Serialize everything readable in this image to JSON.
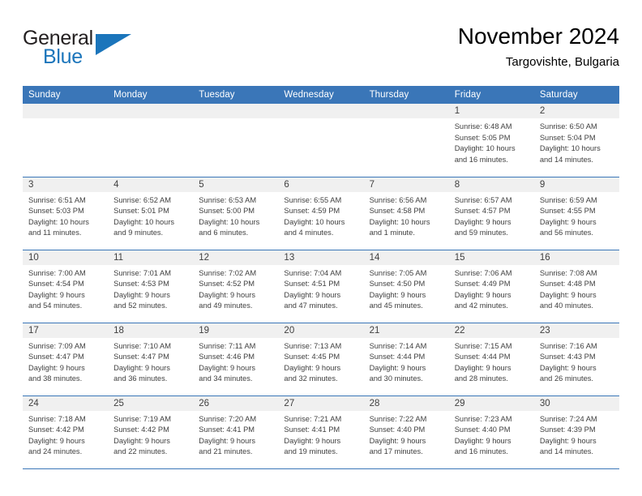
{
  "logo": {
    "word1": "General",
    "word2": "Blue",
    "accent_color": "#1b75bb"
  },
  "header": {
    "title": "November 2024",
    "location": "Targovishte, Bulgaria",
    "header_bg": "#3a76b8",
    "daynum_bg": "#f0f0f0"
  },
  "weekdays": [
    "Sunday",
    "Monday",
    "Tuesday",
    "Wednesday",
    "Thursday",
    "Friday",
    "Saturday"
  ],
  "weeks": [
    [
      {
        "day": "",
        "lines": []
      },
      {
        "day": "",
        "lines": []
      },
      {
        "day": "",
        "lines": []
      },
      {
        "day": "",
        "lines": []
      },
      {
        "day": "",
        "lines": []
      },
      {
        "day": "1",
        "lines": [
          "Sunrise: 6:48 AM",
          "Sunset: 5:05 PM",
          "Daylight: 10 hours",
          "and 16 minutes."
        ]
      },
      {
        "day": "2",
        "lines": [
          "Sunrise: 6:50 AM",
          "Sunset: 5:04 PM",
          "Daylight: 10 hours",
          "and 14 minutes."
        ]
      }
    ],
    [
      {
        "day": "3",
        "lines": [
          "Sunrise: 6:51 AM",
          "Sunset: 5:03 PM",
          "Daylight: 10 hours",
          "and 11 minutes."
        ]
      },
      {
        "day": "4",
        "lines": [
          "Sunrise: 6:52 AM",
          "Sunset: 5:01 PM",
          "Daylight: 10 hours",
          "and 9 minutes."
        ]
      },
      {
        "day": "5",
        "lines": [
          "Sunrise: 6:53 AM",
          "Sunset: 5:00 PM",
          "Daylight: 10 hours",
          "and 6 minutes."
        ]
      },
      {
        "day": "6",
        "lines": [
          "Sunrise: 6:55 AM",
          "Sunset: 4:59 PM",
          "Daylight: 10 hours",
          "and 4 minutes."
        ]
      },
      {
        "day": "7",
        "lines": [
          "Sunrise: 6:56 AM",
          "Sunset: 4:58 PM",
          "Daylight: 10 hours",
          "and 1 minute."
        ]
      },
      {
        "day": "8",
        "lines": [
          "Sunrise: 6:57 AM",
          "Sunset: 4:57 PM",
          "Daylight: 9 hours",
          "and 59 minutes."
        ]
      },
      {
        "day": "9",
        "lines": [
          "Sunrise: 6:59 AM",
          "Sunset: 4:55 PM",
          "Daylight: 9 hours",
          "and 56 minutes."
        ]
      }
    ],
    [
      {
        "day": "10",
        "lines": [
          "Sunrise: 7:00 AM",
          "Sunset: 4:54 PM",
          "Daylight: 9 hours",
          "and 54 minutes."
        ]
      },
      {
        "day": "11",
        "lines": [
          "Sunrise: 7:01 AM",
          "Sunset: 4:53 PM",
          "Daylight: 9 hours",
          "and 52 minutes."
        ]
      },
      {
        "day": "12",
        "lines": [
          "Sunrise: 7:02 AM",
          "Sunset: 4:52 PM",
          "Daylight: 9 hours",
          "and 49 minutes."
        ]
      },
      {
        "day": "13",
        "lines": [
          "Sunrise: 7:04 AM",
          "Sunset: 4:51 PM",
          "Daylight: 9 hours",
          "and 47 minutes."
        ]
      },
      {
        "day": "14",
        "lines": [
          "Sunrise: 7:05 AM",
          "Sunset: 4:50 PM",
          "Daylight: 9 hours",
          "and 45 minutes."
        ]
      },
      {
        "day": "15",
        "lines": [
          "Sunrise: 7:06 AM",
          "Sunset: 4:49 PM",
          "Daylight: 9 hours",
          "and 42 minutes."
        ]
      },
      {
        "day": "16",
        "lines": [
          "Sunrise: 7:08 AM",
          "Sunset: 4:48 PM",
          "Daylight: 9 hours",
          "and 40 minutes."
        ]
      }
    ],
    [
      {
        "day": "17",
        "lines": [
          "Sunrise: 7:09 AM",
          "Sunset: 4:47 PM",
          "Daylight: 9 hours",
          "and 38 minutes."
        ]
      },
      {
        "day": "18",
        "lines": [
          "Sunrise: 7:10 AM",
          "Sunset: 4:47 PM",
          "Daylight: 9 hours",
          "and 36 minutes."
        ]
      },
      {
        "day": "19",
        "lines": [
          "Sunrise: 7:11 AM",
          "Sunset: 4:46 PM",
          "Daylight: 9 hours",
          "and 34 minutes."
        ]
      },
      {
        "day": "20",
        "lines": [
          "Sunrise: 7:13 AM",
          "Sunset: 4:45 PM",
          "Daylight: 9 hours",
          "and 32 minutes."
        ]
      },
      {
        "day": "21",
        "lines": [
          "Sunrise: 7:14 AM",
          "Sunset: 4:44 PM",
          "Daylight: 9 hours",
          "and 30 minutes."
        ]
      },
      {
        "day": "22",
        "lines": [
          "Sunrise: 7:15 AM",
          "Sunset: 4:44 PM",
          "Daylight: 9 hours",
          "and 28 minutes."
        ]
      },
      {
        "day": "23",
        "lines": [
          "Sunrise: 7:16 AM",
          "Sunset: 4:43 PM",
          "Daylight: 9 hours",
          "and 26 minutes."
        ]
      }
    ],
    [
      {
        "day": "24",
        "lines": [
          "Sunrise: 7:18 AM",
          "Sunset: 4:42 PM",
          "Daylight: 9 hours",
          "and 24 minutes."
        ]
      },
      {
        "day": "25",
        "lines": [
          "Sunrise: 7:19 AM",
          "Sunset: 4:42 PM",
          "Daylight: 9 hours",
          "and 22 minutes."
        ]
      },
      {
        "day": "26",
        "lines": [
          "Sunrise: 7:20 AM",
          "Sunset: 4:41 PM",
          "Daylight: 9 hours",
          "and 21 minutes."
        ]
      },
      {
        "day": "27",
        "lines": [
          "Sunrise: 7:21 AM",
          "Sunset: 4:41 PM",
          "Daylight: 9 hours",
          "and 19 minutes."
        ]
      },
      {
        "day": "28",
        "lines": [
          "Sunrise: 7:22 AM",
          "Sunset: 4:40 PM",
          "Daylight: 9 hours",
          "and 17 minutes."
        ]
      },
      {
        "day": "29",
        "lines": [
          "Sunrise: 7:23 AM",
          "Sunset: 4:40 PM",
          "Daylight: 9 hours",
          "and 16 minutes."
        ]
      },
      {
        "day": "30",
        "lines": [
          "Sunrise: 7:24 AM",
          "Sunset: 4:39 PM",
          "Daylight: 9 hours",
          "and 14 minutes."
        ]
      }
    ]
  ]
}
